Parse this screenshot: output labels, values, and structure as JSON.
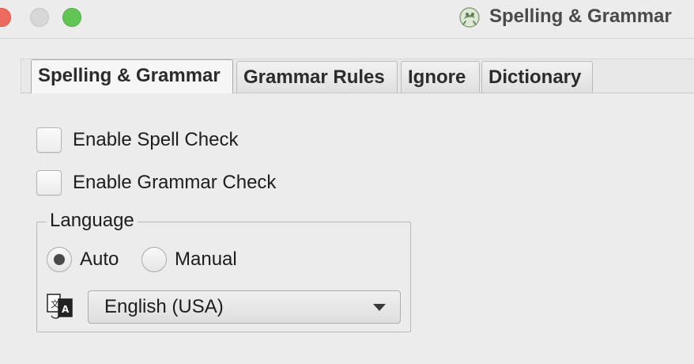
{
  "window": {
    "title": "Spelling & Grammar",
    "app_icon": "frog-icon"
  },
  "tabs": [
    {
      "label": "Spelling & Grammar",
      "active": true
    },
    {
      "label": "Grammar Rules",
      "active": false
    },
    {
      "label": "Ignore",
      "active": false
    },
    {
      "label": "Dictionary",
      "active": false
    }
  ],
  "checks": {
    "spell": {
      "label": "Enable Spell Check",
      "checked": false
    },
    "grammar": {
      "label": "Enable Grammar Check",
      "checked": false
    }
  },
  "language": {
    "legend": "Language",
    "options": [
      {
        "label": "Auto",
        "selected": true
      },
      {
        "label": "Manual",
        "selected": false
      }
    ],
    "icon": "translate-icon",
    "selected_value": "English (USA)"
  },
  "colors": {
    "close": "#ed6a5e",
    "minimize": "#d7d7d7",
    "maximize": "#61c554"
  }
}
